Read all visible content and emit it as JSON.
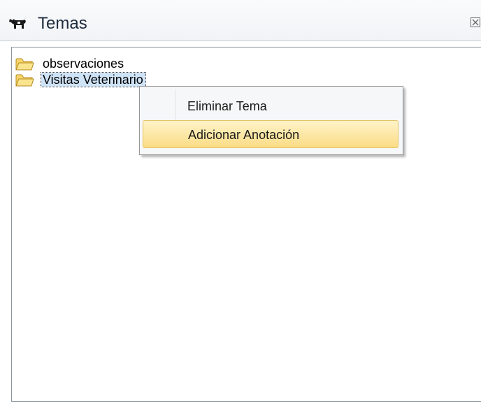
{
  "panel": {
    "title": "Temas",
    "title_icon": "cow-icon",
    "close_icon": "close-icon"
  },
  "tree": {
    "items": [
      {
        "label": "observaciones",
        "icon": "folder-icon",
        "selected": false
      },
      {
        "label": "Visitas Veterinario",
        "icon": "folder-icon",
        "selected": true
      }
    ]
  },
  "context_menu": {
    "items": [
      {
        "label": "Eliminar Tema",
        "highlighted": false
      },
      {
        "label": "Adicionar Anotación",
        "highlighted": true
      }
    ]
  },
  "colors": {
    "selection_background": "#cfe3f7",
    "menu_highlight": "#fbdc86",
    "folder_fill": "#f6d66b"
  }
}
